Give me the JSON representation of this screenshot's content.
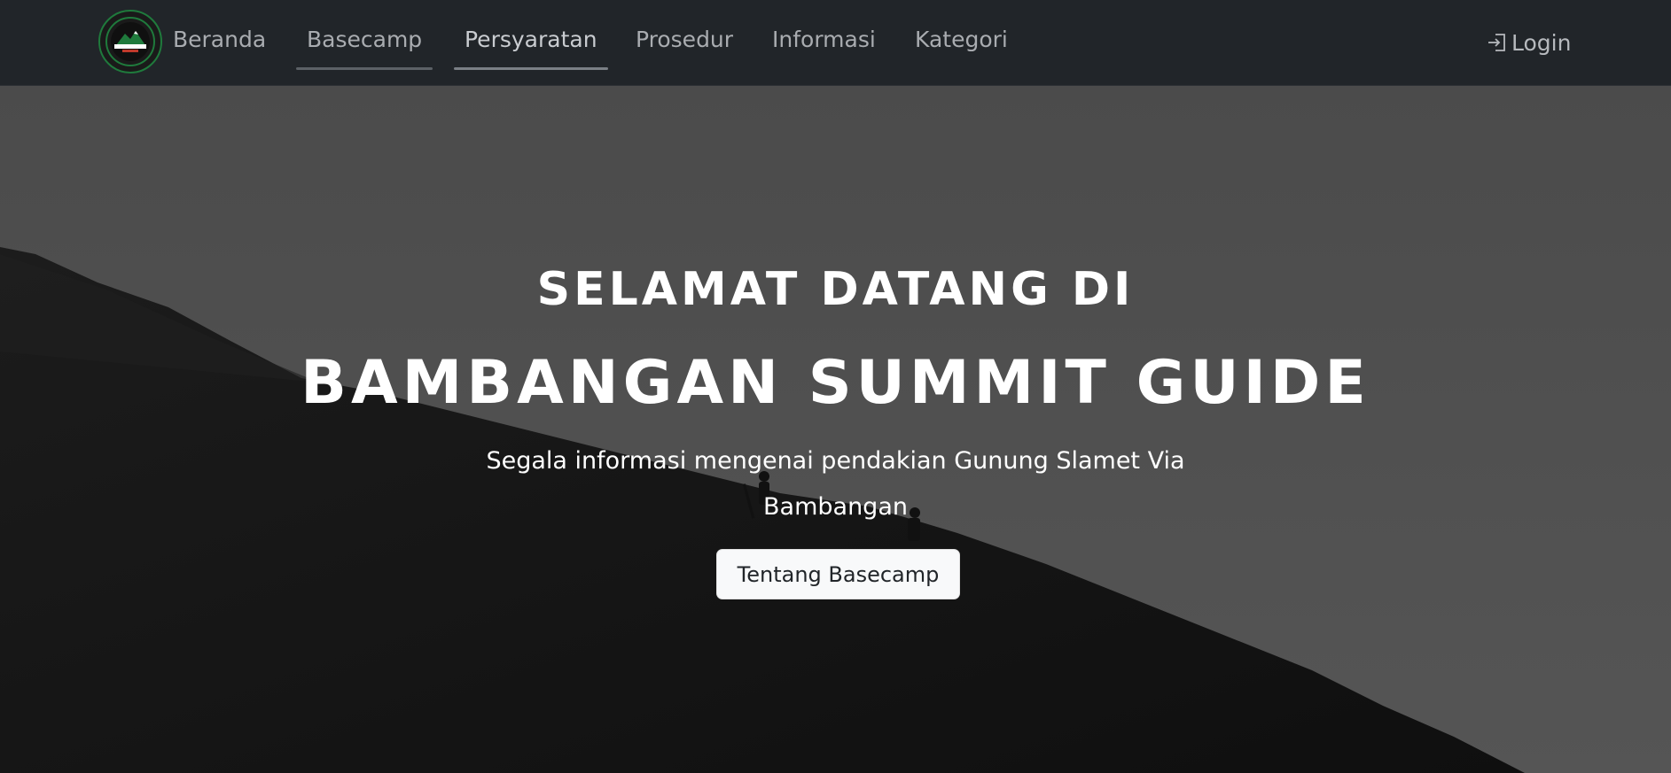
{
  "nav": {
    "logo_alt": "Basecamp Bambangan logo",
    "links": [
      {
        "label": "Beranda"
      },
      {
        "label": "Basecamp"
      },
      {
        "label": "Persyaratan"
      },
      {
        "label": "Prosedur"
      },
      {
        "label": "Informasi"
      },
      {
        "label": "Kategori"
      }
    ],
    "login_label": "Login",
    "login_icon": "login-icon"
  },
  "hero": {
    "line1": "Selamat Datang Di",
    "line2": "Bambangan Summit Guide",
    "subtitle": "Segala informasi mengenai pendakian Gunung Slamet Via Bambangan",
    "button_label": "Tentang Basecamp"
  },
  "colors": {
    "navbar_bg": "#212529",
    "nav_text": "#a9acb0",
    "hero_sky": "#4a4a4a",
    "hero_slope": "#151515",
    "button_bg": "#f8f9fa",
    "logo_green": "#1f7a3c"
  }
}
